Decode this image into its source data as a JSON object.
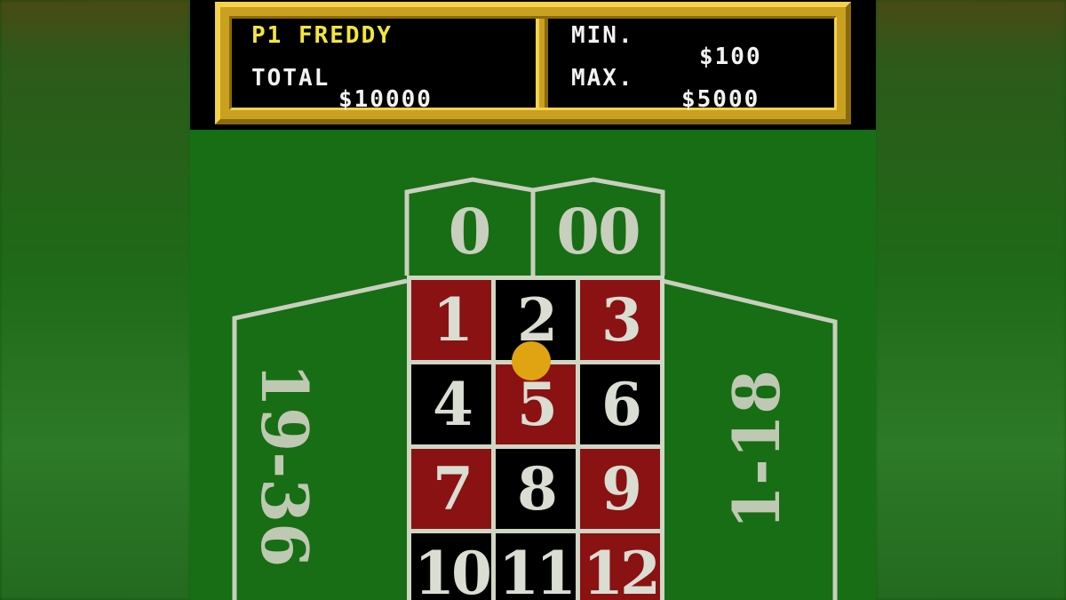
{
  "hud": {
    "player": "P1 FREDDY",
    "total_label": "TOTAL",
    "total_value": "$10000",
    "min_label": "MIN.",
    "min_value": "$100",
    "max_label": "MAX.",
    "max_value": "$5000"
  },
  "table": {
    "zero": "0",
    "double_zero": "00",
    "left_bet": "19-36",
    "right_bet": "1-18",
    "cells": [
      {
        "number": "1",
        "color": "red"
      },
      {
        "number": "2",
        "color": "black"
      },
      {
        "number": "3",
        "color": "red"
      },
      {
        "number": "4",
        "color": "black"
      },
      {
        "number": "5",
        "color": "red"
      },
      {
        "number": "6",
        "color": "black"
      },
      {
        "number": "7",
        "color": "red"
      },
      {
        "number": "8",
        "color": "black"
      },
      {
        "number": "9",
        "color": "red"
      },
      {
        "number": "10",
        "color": "black"
      },
      {
        "number": "11",
        "color": "black"
      },
      {
        "number": "12",
        "color": "red"
      }
    ]
  },
  "colors": {
    "felt": "#176e14",
    "red": "#8a1212",
    "black": "#000000",
    "gold": "#c9a020",
    "chip": "#e0a412"
  }
}
